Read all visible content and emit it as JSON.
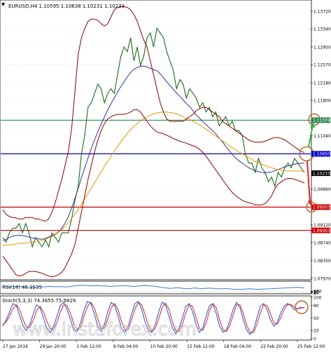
{
  "chart_data": [
    {
      "type": "line",
      "panel": "price",
      "symbol": "EURUSD",
      "timeframe": "H4",
      "title": "EURUSD,H4  1.10595 1.10638 1.10231 1.10233",
      "ohlc": {
        "open": 1.10595,
        "high": 1.10638,
        "low": 1.10231,
        "close": 1.10233
      },
      "ylim": [
        1.0797,
        1.1387
      ],
      "y_ticks": [
        {
          "value": 1.1372,
          "label": "1.13720"
        },
        {
          "value": 1.1334,
          "label": "1.13340"
        },
        {
          "value": 1.1295,
          "label": "1.12950"
        },
        {
          "value": 1.1257,
          "label": "1.12570"
        },
        {
          "value": 1.1218,
          "label": "1.12180"
        },
        {
          "value": 1.118,
          "label": "1.11800"
        },
        {
          "value": 1.1104,
          "label": "1.11040"
        },
        {
          "value": 1.0989,
          "label": "1.09890"
        },
        {
          "value": 1.0912,
          "label": "1.09120"
        },
        {
          "value": 1.0874,
          "label": "1.08740"
        },
        {
          "value": 1.0835,
          "label": "1.08350"
        },
        {
          "value": 1.0797,
          "label": "1.07970"
        }
      ],
      "levels": [
        {
          "value": 1.11374,
          "label": "1.11374",
          "color": "#2e8b57"
        },
        {
          "value": 1.1065,
          "label": "1.10650",
          "color": "#0000cc"
        },
        {
          "value": 1.10233,
          "label": "1.10233",
          "color": "#000000"
        },
        {
          "value": 1.09503,
          "label": "1.09503",
          "color": "#cc0000"
        },
        {
          "value": 1.09003,
          "label": "1.09003",
          "color": "#cc0000"
        }
      ],
      "x_labels": [
        "27 Jan 2016",
        "29 Jan 20:00",
        "3 Feb 12:00",
        "8 Feb 04:00",
        "10 Feb 20:00",
        "15 Feb 12:00",
        "18 Feb 04:00",
        "22 Feb 20:00",
        "25 Feb 12:00"
      ],
      "series": [
        {
          "role": "close",
          "color": "#1a6b1a",
          "values": [
            1.0885,
            1.0875,
            1.0895,
            1.0905,
            1.0905,
            1.0915,
            1.0895,
            1.0915,
            1.0895,
            1.0865,
            1.0885,
            1.0875,
            1.0865,
            1.088,
            1.0865,
            1.0895,
            1.0885,
            1.0875,
            1.0895,
            1.0895,
            1.0895,
            1.0925,
            1.0965,
            1.0995,
            1.1065,
            1.1105,
            1.1165,
            1.1175,
            1.1195,
            1.1215,
            1.1205,
            1.1175,
            1.1195,
            1.1205,
            1.1195,
            1.1235,
            1.1275,
            1.1295,
            1.1285,
            1.1315,
            1.1265,
            1.1295,
            1.1255,
            1.1275,
            1.1315,
            1.1325,
            1.1295,
            1.1335,
            1.1325,
            1.1315,
            1.1285,
            1.1265,
            1.1245,
            1.1205,
            1.1225,
            1.1215,
            1.1185,
            1.1205,
            1.1195,
            1.1185,
            1.1165,
            1.1175,
            1.1155,
            1.1165,
            1.1145,
            1.1155,
            1.1125,
            1.1135,
            1.1145,
            1.1125,
            1.1135,
            1.1115,
            1.1115,
            1.1105,
            1.1065,
            1.1045,
            1.1045,
            1.1025,
            1.1055,
            1.1035,
            1.1025,
            1.1005,
            1.1015,
            1.0995,
            1.1025,
            1.1015,
            1.1035,
            1.1045,
            1.1035,
            1.1055,
            1.1045,
            1.1035,
            1.1025
          ]
        },
        {
          "role": "moving-average-fast",
          "color": "#333399",
          "values": [
            1.0878,
            1.0881,
            1.0885,
            1.0888,
            1.0889,
            1.089,
            1.0889,
            1.0888,
            1.0886,
            1.0884,
            1.0883,
            1.0882,
            1.0881,
            1.0883,
            1.0886,
            1.0889,
            1.0892,
            1.0897,
            1.0905,
            1.0916,
            1.093,
            1.0948,
            1.0969,
            1.0991,
            1.1014,
            1.1035,
            1.1056,
            1.1077,
            1.1095,
            1.1113,
            1.1129,
            1.1144,
            1.1159,
            1.1173,
            1.1185,
            1.1198,
            1.121,
            1.122,
            1.1231,
            1.124,
            1.1247,
            1.1251,
            1.1253,
            1.1254,
            1.1252,
            1.1249,
            1.1246,
            1.1244,
            1.1237,
            1.1229,
            1.122,
            1.1212,
            1.1204,
            1.1196,
            1.1189,
            1.1181,
            1.1173,
            1.1167,
            1.1158,
            1.1149,
            1.1142,
            1.1134,
            1.1128,
            1.1121,
            1.1115,
            1.1108,
            1.1099,
            1.1091,
            1.1081,
            1.1072,
            1.1064,
            1.1056,
            1.105,
            1.1045,
            1.104,
            1.1035,
            1.1032,
            1.1029,
            1.1027,
            1.1025,
            1.1024,
            1.1025,
            1.1026,
            1.1029,
            1.1031,
            1.1034,
            1.1037,
            1.1039,
            1.1041,
            1.1043,
            1.1044,
            1.1045,
            1.1045
          ]
        },
        {
          "role": "moving-average-slow",
          "color": "#e69a00",
          "values": [
            1.0868,
            1.0868,
            1.0869,
            1.087,
            1.0871,
            1.0872,
            1.0872,
            1.0873,
            1.0874,
            1.0875,
            1.0876,
            1.0877,
            1.0879,
            1.0881,
            1.0884,
            1.0887,
            1.0891,
            1.0896,
            1.0902,
            1.0909,
            1.0917,
            1.0926,
            1.0935,
            1.0946,
            1.0957,
            1.0968,
            1.098,
            1.0991,
            1.1003,
            1.1015,
            1.1026,
            1.1038,
            1.1049,
            1.106,
            1.1071,
            1.1081,
            1.1091,
            1.11,
            1.1109,
            1.1117,
            1.1124,
            1.113,
            1.1136,
            1.1141,
            1.1145,
            1.1148,
            1.1151,
            1.1153,
            1.1154,
            1.1155,
            1.1155,
            1.1154,
            1.1153,
            1.1151,
            1.1148,
            1.1145,
            1.1142,
            1.1139,
            1.1135,
            1.1131,
            1.1127,
            1.1123,
            1.1118,
            1.1113,
            1.1108,
            1.1103,
            1.1098,
            1.1093,
            1.1088,
            1.1083,
            1.1078,
            1.1074,
            1.1069,
            1.1065,
            1.1061,
            1.1057,
            1.1053,
            1.1049,
            1.1046,
            1.1043,
            1.104,
            1.1037,
            1.1035,
            1.1033,
            1.1031,
            1.103,
            1.1029,
            1.1028,
            1.1028,
            1.1028,
            1.1028,
            1.1028,
            1.1029
          ]
        },
        {
          "role": "bollinger-upper",
          "color": "#8b0000",
          "values": [
            1.0945,
            1.0935,
            1.093,
            1.0928,
            1.0927,
            1.0925,
            1.0925,
            1.0928,
            1.0928,
            1.0928,
            1.0925,
            1.0925,
            1.0922,
            1.092,
            1.0925,
            1.094,
            1.096,
            1.0985,
            1.101,
            1.104,
            1.107,
            1.112,
            1.12,
            1.128,
            1.1315,
            1.1335,
            1.135,
            1.1355,
            1.1355,
            1.1352,
            1.1345,
            1.134,
            1.1345,
            1.136,
            1.1375,
            1.138,
            1.1382,
            1.1382,
            1.138,
            1.1375,
            1.1365,
            1.135,
            1.133,
            1.131,
            1.1295,
            1.1265,
            1.1235,
            1.1205,
            1.1175,
            1.1155,
            1.114,
            1.1135,
            1.1135,
            1.1135,
            1.1135,
            1.1135,
            1.114,
            1.1145,
            1.115,
            1.1158,
            1.1162,
            1.1165,
            1.1165,
            1.116,
            1.1155,
            1.115,
            1.1145,
            1.1135,
            1.113,
            1.1125,
            1.112,
            1.1115,
            1.111,
            1.1105,
            1.11,
            1.1095,
            1.1092,
            1.109,
            1.109,
            1.109,
            1.1092,
            1.1095,
            1.1098,
            1.11,
            1.11,
            1.1098,
            1.1095,
            1.109,
            1.1085,
            1.108,
            1.1075,
            1.107,
            1.1068
          ]
        },
        {
          "role": "bollinger-lower",
          "color": "#8b0000",
          "values": [
            1.0845,
            1.0835,
            1.0825,
            1.0815,
            1.0805,
            1.0802,
            1.0804,
            1.0808,
            1.0812,
            1.0812,
            1.0812,
            1.081,
            1.0808,
            1.0805,
            1.0802,
            1.08,
            1.0802,
            1.0805,
            1.081,
            1.082,
            1.0835,
            1.085,
            1.087,
            1.0905,
            1.094,
            1.0975,
            1.101,
            1.104,
            1.107,
            1.1095,
            1.1115,
            1.113,
            1.114,
            1.1145,
            1.1148,
            1.115,
            1.115,
            1.115,
            1.1152,
            1.1155,
            1.116,
            1.116,
            1.1155,
            1.1145,
            1.1135,
            1.1125,
            1.1118,
            1.1112,
            1.111,
            1.1108,
            1.1105,
            1.1102,
            1.1098,
            1.1095,
            1.1092,
            1.109,
            1.1088,
            1.1085,
            1.1082,
            1.108,
            1.1075,
            1.1068,
            1.106,
            1.105,
            1.104,
            1.103,
            1.102,
            1.101,
            1.1,
            1.099,
            1.0982,
            1.0975,
            1.097,
            1.0965,
            1.0962,
            1.096,
            1.0958,
            1.0955,
            1.0955,
            1.0955,
            1.0958,
            1.0965,
            1.0975,
            1.099,
            1.1,
            1.1005,
            1.101,
            1.1012,
            1.1012,
            1.101,
            1.1008,
            1.1005,
            1.1002
          ]
        }
      ]
    },
    {
      "type": "line",
      "panel": "rsi",
      "title": "RSI(14) 46.3535",
      "ylim": [
        0,
        100
      ],
      "y_ticks": [
        {
          "value": 100,
          "label": "100"
        },
        {
          "value": 70,
          "label": "70"
        },
        {
          "value": 50,
          "label": "50"
        },
        {
          "value": 30,
          "label": "30"
        },
        {
          "value": 0,
          "label": "0"
        }
      ],
      "series": [
        {
          "role": "rsi",
          "color": "#3a7bd5",
          "values": [
            58,
            60,
            57,
            61,
            64,
            66,
            60,
            58,
            56,
            52,
            55,
            60,
            58,
            60,
            64,
            63,
            60,
            61,
            62,
            59,
            60,
            65,
            70,
            72,
            74,
            73,
            72,
            68,
            70,
            71,
            67,
            69,
            66,
            64,
            66,
            67,
            70,
            69,
            68,
            66,
            63,
            66,
            69,
            70,
            71,
            68,
            66,
            62,
            57,
            53,
            48,
            45,
            47,
            50,
            49,
            45,
            42,
            43,
            47,
            48,
            44,
            43,
            46,
            47,
            45,
            43,
            41,
            42,
            44,
            41,
            38,
            36,
            35,
            36,
            38,
            41,
            40,
            37,
            36,
            38,
            39,
            41,
            42,
            44,
            45,
            47,
            49,
            50,
            52,
            54,
            55,
            53,
            47
          ]
        }
      ]
    },
    {
      "type": "line",
      "panel": "stochastic",
      "title": "Stoch(5,3,3) 74.3655 75.9829",
      "ylim": [
        0,
        100
      ],
      "y_ticks": [
        {
          "value": 100,
          "label": "100"
        },
        {
          "value": 80,
          "label": "80"
        },
        {
          "value": 50,
          "label": "50"
        },
        {
          "value": 20,
          "label": "20"
        },
        {
          "value": 0,
          "label": "0"
        }
      ],
      "series": [
        {
          "role": "main",
          "color": "#1f4fd6",
          "values": [
            30,
            45,
            65,
            85,
            80,
            55,
            30,
            20,
            35,
            60,
            82,
            75,
            50,
            25,
            15,
            30,
            55,
            80,
            88,
            70,
            45,
            20,
            18,
            40,
            70,
            90,
            85,
            60,
            30,
            18,
            35,
            65,
            88,
            80,
            55,
            25,
            15,
            30,
            60,
            85,
            90,
            70,
            40,
            20,
            15,
            35,
            65,
            88,
            82,
            55,
            28,
            12,
            25,
            50,
            78,
            85,
            65,
            35,
            15,
            25,
            55,
            80,
            85,
            60,
            30,
            15,
            20,
            45,
            72,
            88,
            75,
            45,
            20,
            10,
            22,
            50,
            78,
            85,
            70,
            45,
            30,
            40,
            62,
            78,
            85,
            80,
            70,
            72,
            76,
            74
          ]
        },
        {
          "role": "signal",
          "color": "#d62728",
          "values": [
            35,
            40,
            55,
            72,
            82,
            70,
            45,
            28,
            28,
            45,
            68,
            78,
            65,
            42,
            25,
            22,
            40,
            65,
            82,
            80,
            60,
            35,
            22,
            28,
            55,
            78,
            88,
            75,
            48,
            25,
            25,
            48,
            75,
            85,
            70,
            42,
            22,
            22,
            45,
            72,
            88,
            82,
            58,
            32,
            18,
            25,
            48,
            75,
            86,
            72,
            42,
            20,
            18,
            35,
            62,
            82,
            78,
            52,
            25,
            20,
            38,
            68,
            84,
            75,
            45,
            22,
            18,
            32,
            58,
            82,
            82,
            60,
            32,
            15,
            15,
            35,
            62,
            82,
            80,
            60,
            38,
            35,
            50,
            70,
            82,
            83,
            76,
            72,
            74,
            76
          ]
        }
      ]
    }
  ],
  "colors": {
    "background": "#ffffff",
    "grid": "#d0d0d0",
    "annotation_circle": "#b87333",
    "arrow_up": "#3cb44b",
    "arrow_down": "#e32222"
  },
  "watermark": "www.instaforex.com"
}
